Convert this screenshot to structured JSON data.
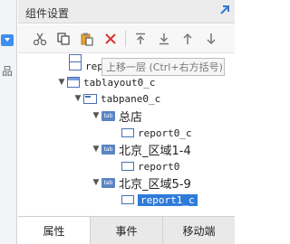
{
  "panel": {
    "title": "组件设置",
    "left_glyph": "品"
  },
  "toolbar": {
    "buttons": [
      {
        "name": "cut-button",
        "icon": "scissors-icon"
      },
      {
        "name": "copy-button",
        "icon": "copy-icon"
      },
      {
        "name": "paste-button",
        "icon": "paste-icon"
      },
      {
        "name": "delete-button",
        "icon": "close-icon"
      },
      {
        "name": "move-top-button",
        "icon": "arrow-up-to-top-icon"
      },
      {
        "name": "move-bottom-button",
        "icon": "arrow-down-to-bottom-icon"
      },
      {
        "name": "move-up-button",
        "icon": "arrow-up-icon"
      },
      {
        "name": "move-down-button",
        "icon": "arrow-down-icon"
      }
    ]
  },
  "tooltip": {
    "text": "上移一层 (Ctrl+右方括号)"
  },
  "tree": {
    "partial_label": "rep",
    "nodes": [
      {
        "label": "tablayout0_c"
      },
      {
        "label": "tabpane0_c"
      },
      {
        "label": "总店"
      },
      {
        "label": "report0_c"
      },
      {
        "label": "北京_区域1-4"
      },
      {
        "label": "report0"
      },
      {
        "label": "北京_区域5-9"
      },
      {
        "label": "report1_c"
      }
    ],
    "tab_icon_text": "tab"
  },
  "tabs": [
    {
      "label": "属性",
      "active": true
    },
    {
      "label": "事件",
      "active": false
    },
    {
      "label": "移动端",
      "active": false
    }
  ],
  "colors": {
    "accent": "#2f7bd8",
    "delete": "#d9342b"
  }
}
